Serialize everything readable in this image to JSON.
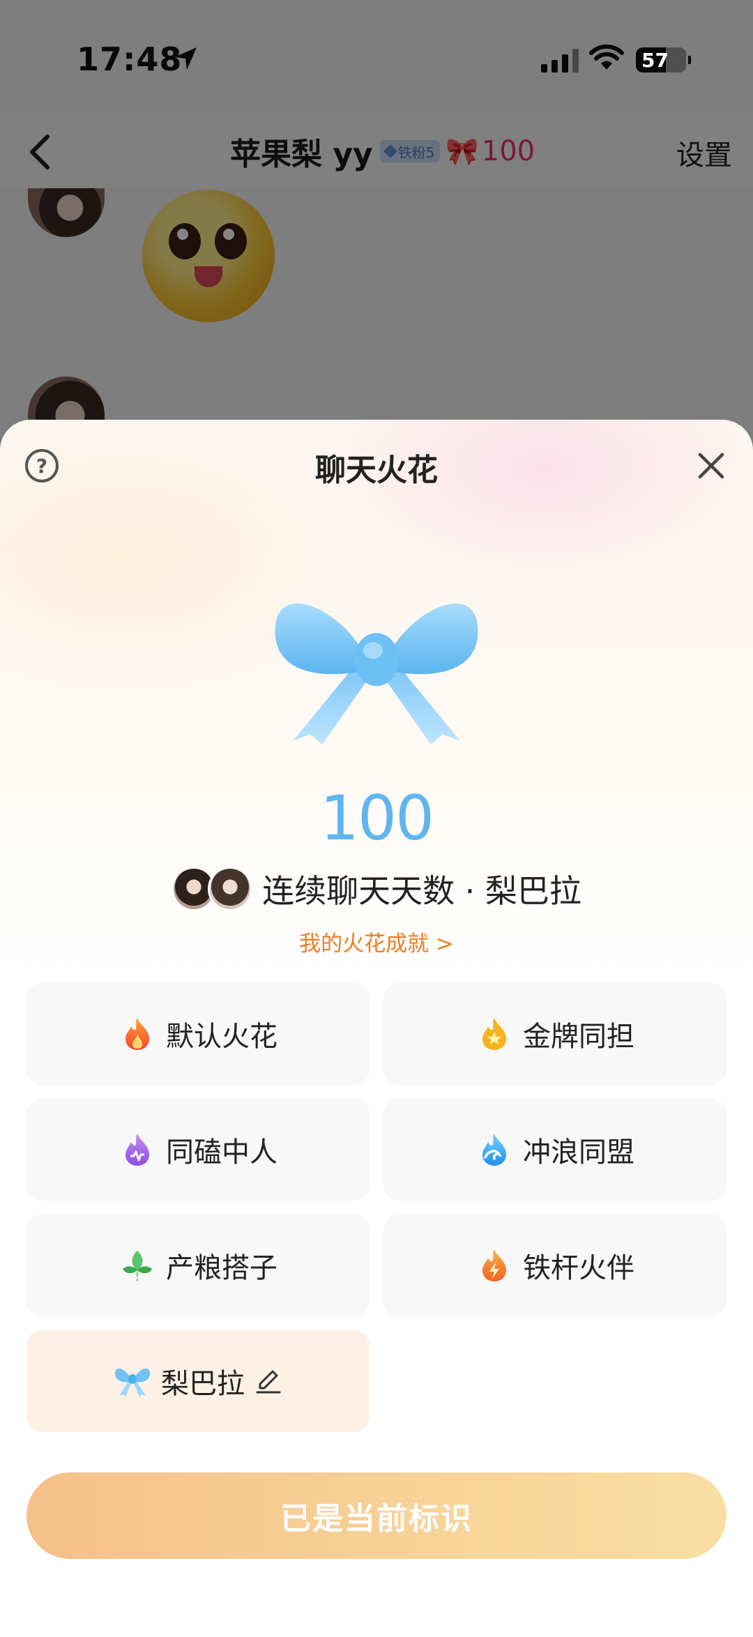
{
  "status_bar": {
    "time": "17:48",
    "battery_level": "57"
  },
  "nav": {
    "title_name": "苹果梨 yy",
    "fan_badge": "铁粉5",
    "spark_emoji": "🎀",
    "spark_count": "100",
    "settings_label": "设置"
  },
  "sheet": {
    "title": "聊天火花",
    "hero_emoji_name": "blue-bow",
    "spark_number": "100",
    "streak_text": "连续聊天天数 · 梨巴拉",
    "achievement_link": "我的火花成就 >",
    "options": [
      {
        "label": "默认火花",
        "icon": "flame-orange-icon",
        "selected": false
      },
      {
        "label": "金牌同担",
        "icon": "gold-star-icon",
        "selected": false
      },
      {
        "label": "同磕中人",
        "icon": "purple-flame-icon",
        "selected": false
      },
      {
        "label": "冲浪同盟",
        "icon": "wave-icon",
        "selected": false
      },
      {
        "label": "产粮搭子",
        "icon": "green-leaf-icon",
        "selected": false
      },
      {
        "label": "铁杆火伴",
        "icon": "lightning-flame-icon",
        "selected": false
      },
      {
        "label": "梨巴拉",
        "icon": "blue-bow-icon",
        "selected": true
      }
    ],
    "primary_button": "已是当前标识"
  },
  "colors": {
    "accent_blue": "#5fb6ef",
    "link_orange": "#ef7d23",
    "button_gradient_start": "#f5c089",
    "button_gradient_end": "#f9dea3",
    "spark_count_red": "#e8336e"
  }
}
